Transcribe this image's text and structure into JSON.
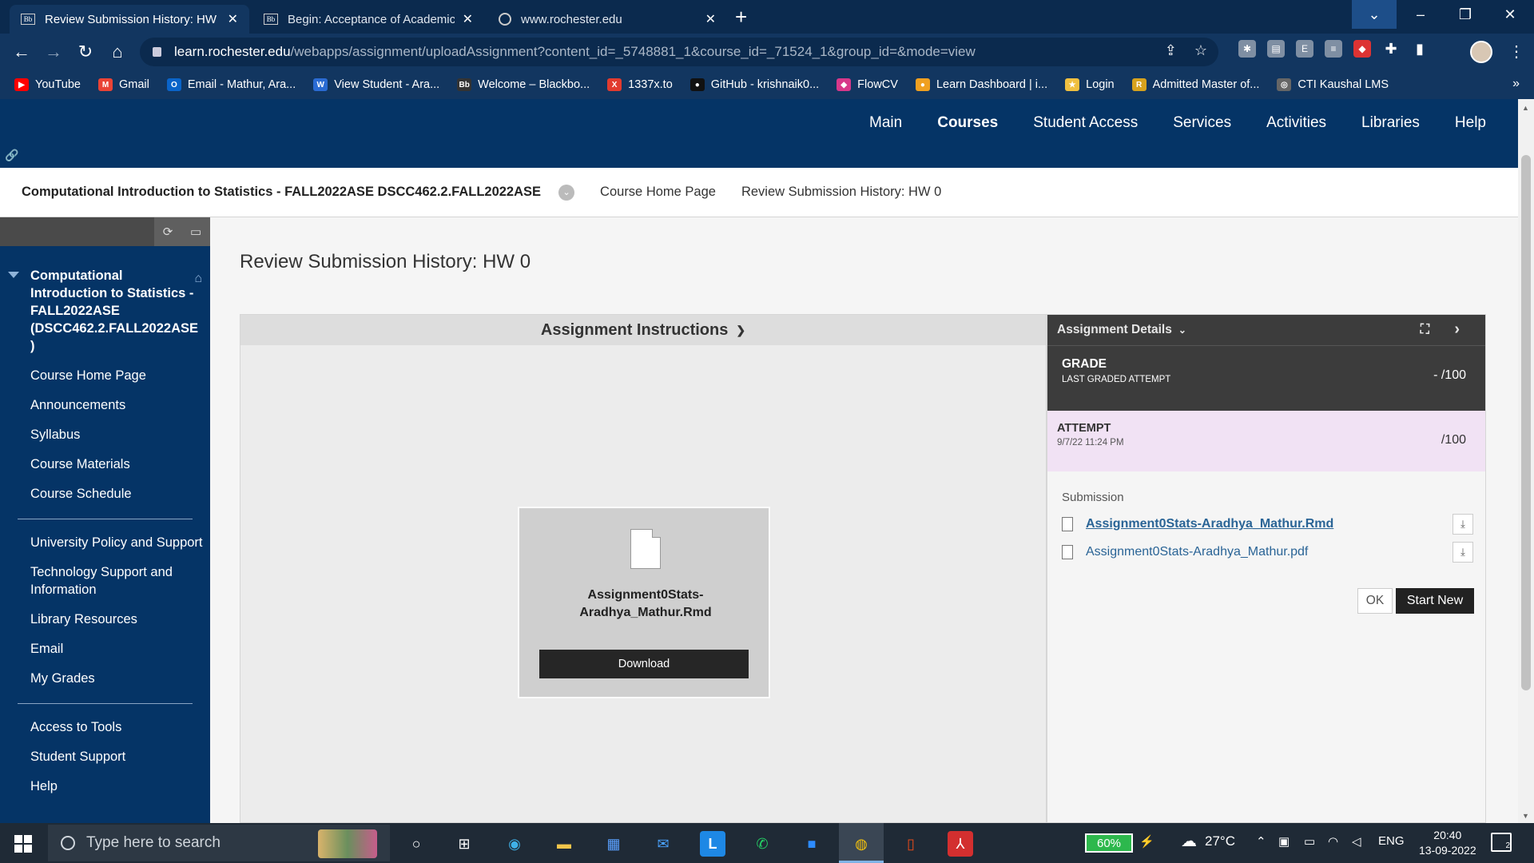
{
  "browser": {
    "tabs": [
      {
        "title": "Review Submission History: HW 0",
        "favicon": "Bb",
        "active": true
      },
      {
        "title": "Begin: Acceptance of Academic H",
        "favicon": "Bb",
        "active": false
      },
      {
        "title": "www.rochester.edu",
        "favicon": "globe-icon",
        "active": false
      }
    ],
    "url_host": "learn.rochester.edu",
    "url_path": "/webapps/assignment/uploadAssignment?content_id=_5748881_1&course_id=_71524_1&group_id=&mode=view",
    "bookmarks": [
      {
        "label": "YouTube",
        "color": "#ff0000",
        "glyph": "▶"
      },
      {
        "label": "Gmail",
        "color": "#ea4335",
        "glyph": "M"
      },
      {
        "label": "Email - Mathur, Ara...",
        "color": "#0a64c9",
        "glyph": "O"
      },
      {
        "label": "View Student - Ara...",
        "color": "#2a6bd3",
        "glyph": "W"
      },
      {
        "label": "Welcome – Blackbo...",
        "color": "#333333",
        "glyph": "Bb"
      },
      {
        "label": "1337x.to",
        "color": "#e23b2e",
        "glyph": "X"
      },
      {
        "label": "GitHub - krishnaik0...",
        "color": "#111111",
        "glyph": "●"
      },
      {
        "label": "FlowCV",
        "color": "#d8388a",
        "glyph": "◆"
      },
      {
        "label": "Learn Dashboard | i...",
        "color": "#f0a020",
        "glyph": "●"
      },
      {
        "label": "Login",
        "color": "#f0c040",
        "glyph": "★"
      },
      {
        "label": "Admitted Master of...",
        "color": "#d6a21e",
        "glyph": "R"
      },
      {
        "label": "CTI Kaushal LMS",
        "color": "#666666",
        "glyph": "◎"
      }
    ]
  },
  "bb": {
    "nav": [
      "Main",
      "Courses",
      "Student Access",
      "Services",
      "Activities",
      "Libraries",
      "Help"
    ],
    "active_nav": "Courses",
    "course_title": "Computational Introduction to Statistics - FALL2022ASE DSCC462.2.FALL2022ASE",
    "crumbs": [
      "Course Home Page",
      "Review Submission History: HW 0"
    ],
    "sidebar": {
      "course": "Computational Introduction to Statistics - FALL2022ASE (DSCC462.2.FALL2022ASE )",
      "group1": [
        "Course Home Page",
        "Announcements",
        "Syllabus",
        "Course Materials",
        "Course Schedule"
      ],
      "group2": [
        "University Policy and Support",
        "Technology Support and Information",
        "Library Resources",
        "Email",
        "My Grades"
      ],
      "group3": [
        "Access to Tools",
        "Student Support",
        "Help"
      ]
    },
    "page_title": "Review Submission History: HW 0",
    "instructions_label": "Assignment Instructions",
    "file_card": {
      "name": "Assignment0Stats-Aradhya_Mathur.Rmd",
      "download": "Download"
    },
    "details": {
      "header": "Assignment Details",
      "grade_label": "GRADE",
      "grade_sub": "LAST GRADED ATTEMPT",
      "grade_value": "- /100",
      "attempt_label": "ATTEMPT",
      "attempt_date": "9/7/22 11:24 PM",
      "attempt_value": "/100",
      "submission_label": "Submission",
      "files": [
        "Assignment0Stats-Aradhya_Mathur.Rmd",
        "Assignment0Stats-Aradhya_Mathur.pdf"
      ],
      "ok": "OK",
      "start_new": "Start New"
    }
  },
  "taskbar": {
    "search_placeholder": "Type here to search",
    "battery": "60%",
    "weather": "27°C",
    "lang": "ENG",
    "time": "20:40",
    "date": "13-09-2022",
    "notifications": "2"
  }
}
